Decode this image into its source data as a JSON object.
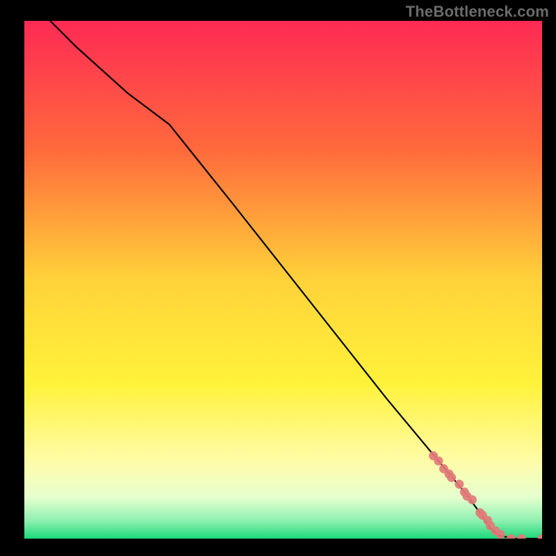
{
  "watermark": "TheBottleneck.com",
  "chart_data": {
    "type": "line",
    "title": "",
    "xlabel": "",
    "ylabel": "",
    "xlim": [
      0,
      100
    ],
    "ylim": [
      0,
      100
    ],
    "grid": false,
    "gradient_stops": [
      {
        "offset": 0.0,
        "color": "#ff2a55"
      },
      {
        "offset": 0.25,
        "color": "#ff6a3c"
      },
      {
        "offset": 0.5,
        "color": "#ffd23a"
      },
      {
        "offset": 0.7,
        "color": "#fff23a"
      },
      {
        "offset": 0.85,
        "color": "#fffca8"
      },
      {
        "offset": 0.92,
        "color": "#e6ffcf"
      },
      {
        "offset": 0.965,
        "color": "#8ff0b0"
      },
      {
        "offset": 1.0,
        "color": "#1cd87a"
      }
    ],
    "series": [
      {
        "name": "curve",
        "color": "#000000",
        "style": "line",
        "x": [
          5,
          10,
          20,
          28,
          40,
          55,
          70,
          80,
          85,
          88,
          90,
          92,
          95,
          100
        ],
        "y": [
          100,
          95,
          86,
          80,
          65,
          46,
          27,
          15,
          9,
          5,
          2,
          0.5,
          0,
          0
        ]
      },
      {
        "name": "points",
        "color": "#e27a7a",
        "style": "scatter",
        "x": [
          79,
          80,
          81,
          82,
          82.5,
          84,
          85,
          85.5,
          86.5,
          88,
          88.5,
          89.5,
          90,
          91,
          92,
          94,
          96,
          100
        ],
        "y": [
          16,
          15,
          13.5,
          12.5,
          11.8,
          10.5,
          9,
          8.2,
          7.5,
          5,
          4.5,
          3.5,
          2.5,
          1.5,
          0.8,
          0,
          0,
          0
        ]
      }
    ]
  }
}
